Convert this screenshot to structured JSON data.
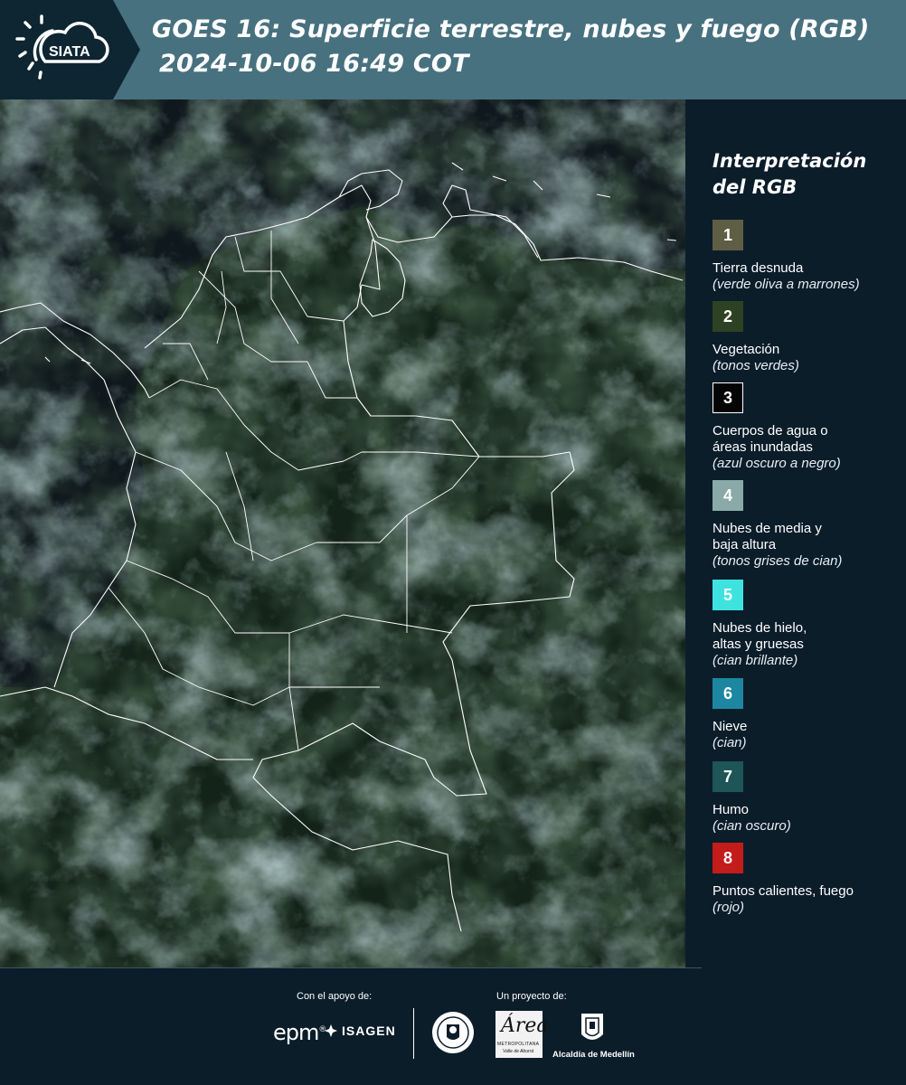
{
  "header": {
    "logo_text": "SIATA",
    "title_line1": "GOES 16: Superficie terrestre, nubes y fuego (RGB)",
    "title_line2": "2024-10-06 16:49 COT"
  },
  "legend": {
    "title_line1": "Interpretación",
    "title_line2": "del RGB",
    "items": [
      {
        "num": "1",
        "label": "Tierra desnuda",
        "note": "(verde oliva a marrones)",
        "color": "#5e5e44"
      },
      {
        "num": "2",
        "label": "Vegetación",
        "note": "(tonos verdes)",
        "color": "#2d4222"
      },
      {
        "num": "3",
        "label_line1": "Cuerpos de agua o",
        "label_line2": "áreas inundadas",
        "note": "(azul oscuro a negro)",
        "color": "#050505"
      },
      {
        "num": "4",
        "label_line1": "Nubes de media y",
        "label_line2": "baja altura",
        "note": "(tonos grises de cian)",
        "color": "#8aa9a9"
      },
      {
        "num": "5",
        "label_line1": "Nubes de hielo,",
        "label_line2": "altas y gruesas",
        "note": "(cian brillante)",
        "color": "#3ee3e0"
      },
      {
        "num": "6",
        "label": "Nieve",
        "note": "(cian)",
        "color": "#1d87a2"
      },
      {
        "num": "7",
        "label": "Humo",
        "note": "(cian oscuro)",
        "color": "#1e5557"
      },
      {
        "num": "8",
        "label": "Puntos calientes, fuego",
        "note": "(rojo)",
        "color": "#c41b1b"
      }
    ]
  },
  "footer": {
    "support_label": "Con el apoyo de:",
    "project_label": "Un proyecto de:",
    "sponsor1": "epm",
    "sponsor2": "ISAGEN",
    "area_line1": "Área",
    "area_line2": "METROPOLITANA",
    "area_line3": "Valle de Aburrá",
    "alcaldia": "Alcaldía de Medellín"
  }
}
